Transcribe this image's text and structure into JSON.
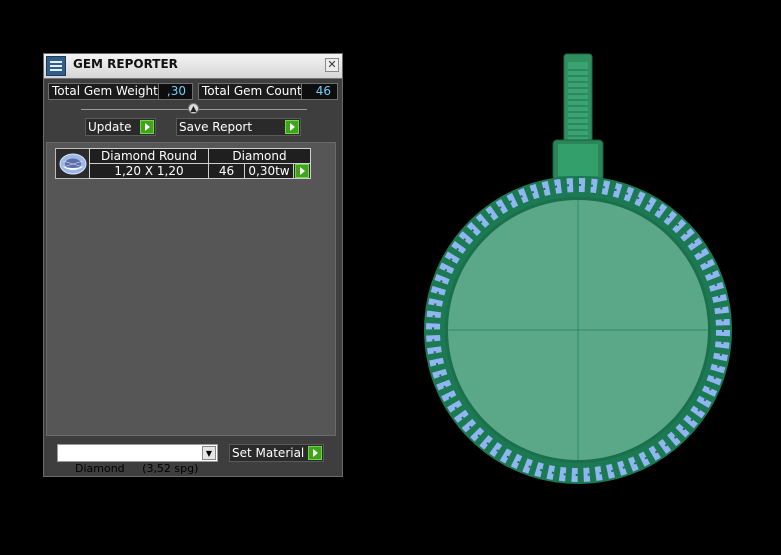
{
  "window": {
    "title": "GEM REPORTER",
    "close_glyph": "✕",
    "icon": "app-icon"
  },
  "summary": {
    "total_weight_label": "Total Gem Weight",
    "total_weight_value": ",30",
    "total_count_label": "Total Gem Count",
    "total_count_value": "46"
  },
  "actions": {
    "update_label": "Update",
    "save_report_label": "Save Report",
    "collapse_glyph": "▲"
  },
  "gems": [
    {
      "shape": "Diamond Round",
      "material": "Diamond",
      "size": "1,20 X 1,20",
      "count": "46",
      "weight": "0,30tw"
    }
  ],
  "footer": {
    "material_select_value": "Diamond     (3,52 spg)",
    "dropdown_glyph": "▼",
    "set_material_label": "Set Material"
  },
  "colors": {
    "accent_go": "#3ea51a",
    "value_text": "#6fd0ff",
    "pendant_green": "#5aa888",
    "gem_blue": "#8fb6f2"
  }
}
